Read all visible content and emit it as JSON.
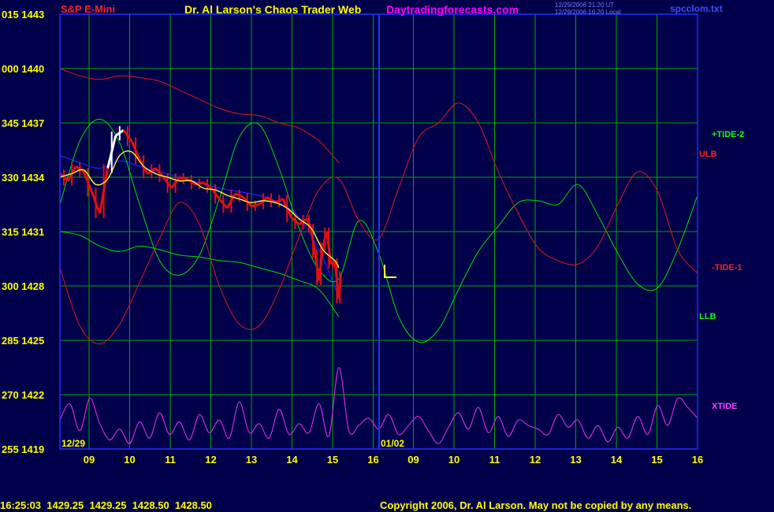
{
  "header": {
    "instrument": "S&P E-Mini",
    "title": "Dr. Al Larson's Chaos Trader Web",
    "website": "Daytradingforecasts.com",
    "timestamp_ut": "12/29/2006 21:20 UT",
    "timestamp_local": "12/29/2006 16:20 Local",
    "file": "spcclom.txt"
  },
  "footer": {
    "quote": "16:25:03  1429.25  1429.25  1428.50  1428.50",
    "copyright": "Copyright 2006, Dr. Al Larson. May not be copied by any means."
  },
  "side_labels": {
    "tide2": "+TIDE-2",
    "ulb": "ULB",
    "tide1": "-TIDE-1",
    "llb": "LLB",
    "xtide": "XTIDE"
  },
  "annotation_marker": "L",
  "colors": {
    "background": "#00004a",
    "grid": "#00a800",
    "axis": "#2030ff",
    "price_down": "#e01010",
    "price_up": "#ffffff",
    "ma_yellow": "#ffff40",
    "ma_blue": "#2222ff",
    "tide_green": "#00e000",
    "ulb_red": "#e01818",
    "xtide_magenta": "#ee30ee",
    "title_yellow": "#ffff00",
    "website_magenta": "#ff00ff"
  },
  "chart_data": {
    "type": "line",
    "title": "Dr. Al Larson's Chaos Trader Web",
    "subtitle": "S&P E-Mini",
    "y_ticks": [
      {
        "osc": "015",
        "price": "1443"
      },
      {
        "osc": "000",
        "price": "1440"
      },
      {
        "osc": "345",
        "price": "1437"
      },
      {
        "osc": "330",
        "price": "1434"
      },
      {
        "osc": "315",
        "price": "1431"
      },
      {
        "osc": "300",
        "price": "1428"
      },
      {
        "osc": "285",
        "price": "1425"
      },
      {
        "osc": "270",
        "price": "1422"
      },
      {
        "osc": "255",
        "price": "1419"
      }
    ],
    "ylim": [
      1419,
      1443
    ],
    "x_ticks": [
      "09",
      "10",
      "11",
      "12",
      "13",
      "14",
      "15",
      "16",
      "09",
      "10",
      "11",
      "12",
      "13",
      "14",
      "15",
      "16"
    ],
    "date_labels": [
      "12/29",
      "01/02"
    ],
    "session_split_hour_index": 7.1,
    "series": [
      {
        "name": "S&P E-Mini",
        "x": [
          0,
          0.2,
          0.4,
          0.6,
          0.8,
          1,
          1.2,
          1.4,
          1.6,
          1.8,
          2,
          2.2,
          2.4,
          2.6,
          2.8,
          3,
          3.2,
          3.4,
          3.6,
          3.8,
          4,
          4.2,
          4.4,
          4.6,
          4.8,
          5,
          5.2,
          5.4,
          5.6,
          5.8,
          6,
          6.2,
          6.3,
          6.4,
          6.5,
          6.6,
          6.7,
          6.8,
          6.9,
          7,
          7.05
        ],
        "y": [
          1434.2,
          1433.8,
          1434.6,
          1434.3,
          1433.2,
          1432.0,
          1434.5,
          1436.3,
          1436.6,
          1436.0,
          1435.0,
          1434.2,
          1434.5,
          1434.0,
          1433.4,
          1434.0,
          1433.9,
          1433.6,
          1433.7,
          1433.4,
          1432.8,
          1432.3,
          1433.1,
          1432.9,
          1432.4,
          1432.5,
          1432.9,
          1432.6,
          1432.8,
          1431.8,
          1431.4,
          1431.7,
          1431.2,
          1429.8,
          1428.3,
          1430.2,
          1431.0,
          1429.2,
          1429.3,
          1427.3,
          1428.6
        ]
      },
      {
        "name": "Moving average (yellow)",
        "x": [
          0,
          0.3,
          0.6,
          0.9,
          1.2,
          1.5,
          1.8,
          2.1,
          2.4,
          2.7,
          3,
          3.3,
          3.6,
          3.9,
          4.2,
          4.5,
          4.8,
          5.1,
          5.4,
          5.7,
          6,
          6.3,
          6.6,
          6.9,
          7
        ],
        "y": [
          1434.0,
          1434.2,
          1434.4,
          1433.6,
          1433.9,
          1435.2,
          1435.4,
          1434.6,
          1434.2,
          1434.0,
          1433.8,
          1433.8,
          1433.4,
          1433.3,
          1433.0,
          1432.8,
          1432.6,
          1432.7,
          1432.6,
          1432.3,
          1431.7,
          1431.2,
          1430.0,
          1429.4,
          1429.0
        ]
      },
      {
        "name": "Moving average (blue)",
        "x": [
          0,
          0.5,
          1,
          1.5,
          2,
          2.5,
          3,
          3.5,
          4,
          4.5,
          5,
          5.5,
          6,
          6.5,
          7
        ],
        "y": [
          1435.2,
          1434.8,
          1434.5,
          1434.9,
          1434.6,
          1434.3,
          1434.0,
          1433.7,
          1433.4,
          1433.2,
          1433.0,
          1432.6,
          1431.8,
          1430.0,
          1427.4
        ]
      },
      {
        "name": "+TIDE-2",
        "x": [
          0,
          0.5,
          1,
          1.5,
          2,
          2.5,
          3,
          3.5,
          4,
          4.5,
          5,
          5.5,
          6,
          6.5,
          7,
          7.5,
          8,
          8.5,
          9,
          9.5,
          10,
          10.5,
          11,
          11.5,
          12,
          12.5,
          13,
          13.5,
          14,
          14.5,
          15,
          15.5,
          16
        ],
        "y": [
          1432.5,
          1436.0,
          1437.2,
          1435.9,
          1432.5,
          1429.4,
          1428.6,
          1429.7,
          1432.8,
          1436.2,
          1436.9,
          1434.5,
          1431.2,
          1428.9,
          1428.4,
          1431.6,
          1429.8,
          1426.3,
          1424.9,
          1425.6,
          1427.8,
          1429.9,
          1431.3,
          1432.6,
          1432.7,
          1432.5,
          1433.6,
          1431.9,
          1429.8,
          1428.1,
          1427.9,
          1430.0,
          1433.0
        ]
      },
      {
        "name": "ULB",
        "x": [
          0,
          0.5,
          1,
          1.5,
          2,
          2.5,
          3,
          3.5,
          4,
          4.5,
          5,
          5.5,
          6,
          6.5,
          7
        ],
        "y": [
          1440.0,
          1439.6,
          1439.4,
          1439.6,
          1439.5,
          1439.3,
          1438.8,
          1438.3,
          1437.8,
          1437.5,
          1437.4,
          1437.0,
          1436.7,
          1436.0,
          1434.8
        ]
      },
      {
        "name": "-TIDE-1",
        "x": [
          0,
          0.5,
          1,
          1.5,
          2,
          2.5,
          3,
          3.5,
          4,
          4.5,
          5,
          5.5,
          6,
          6.5,
          7,
          7.5,
          8,
          8.5,
          9,
          9.5,
          10,
          10.5,
          11,
          11.5,
          12,
          12.5,
          13,
          13.5,
          14,
          14.5,
          15,
          15.5,
          16
        ],
        "y": [
          1429.0,
          1425.8,
          1424.8,
          1425.9,
          1428.2,
          1430.6,
          1432.6,
          1431.4,
          1428.0,
          1425.9,
          1425.8,
          1427.8,
          1430.7,
          1433.3,
          1433.9,
          1431.6,
          1430.6,
          1433.4,
          1436.2,
          1437.0,
          1438.1,
          1437.0,
          1434.3,
          1432.0,
          1430.1,
          1429.4,
          1429.2,
          1430.2,
          1432.5,
          1434.3,
          1433.2,
          1430.0,
          1428.7
        ]
      },
      {
        "name": "LLB",
        "x": [
          0,
          0.5,
          1,
          1.5,
          2,
          2.5,
          3,
          3.5,
          4,
          4.5,
          5,
          5.5,
          6,
          6.5,
          7
        ],
        "y": [
          1431.0,
          1430.8,
          1430.2,
          1429.9,
          1430.2,
          1430.0,
          1429.7,
          1429.6,
          1429.4,
          1429.3,
          1429.0,
          1428.7,
          1428.3,
          1427.8,
          1426.3
        ]
      },
      {
        "name": "XTIDE",
        "x": [
          0,
          0.25,
          0.5,
          0.75,
          1,
          1.25,
          1.5,
          1.75,
          2,
          2.25,
          2.5,
          2.75,
          3,
          3.25,
          3.5,
          3.75,
          4,
          4.25,
          4.5,
          4.75,
          5,
          5.25,
          5.5,
          5.75,
          6,
          6.25,
          6.5,
          6.75,
          7,
          7.25,
          7.5,
          7.75,
          8,
          8.25,
          8.5,
          8.75,
          9,
          9.25,
          9.5,
          9.75,
          10,
          10.25,
          10.5,
          10.75,
          11,
          11.25,
          11.5,
          11.75,
          12,
          12.25,
          12.5,
          12.75,
          13,
          13.25,
          13.5,
          13.75,
          14,
          14.25,
          14.5,
          14.75,
          15,
          15.25,
          15.5,
          15.75,
          16
        ],
        "y": [
          1420.6,
          1421.5,
          1420.0,
          1421.8,
          1420.4,
          1419.5,
          1420.1,
          1419.3,
          1420.5,
          1419.6,
          1421.0,
          1419.8,
          1420.5,
          1419.5,
          1420.9,
          1419.9,
          1420.6,
          1419.6,
          1421.6,
          1419.9,
          1420.4,
          1419.6,
          1421.2,
          1419.8,
          1420.4,
          1419.9,
          1421.5,
          1419.7,
          1423.5,
          1420.0,
          1420.3,
          1420.7,
          1420.1,
          1420.9,
          1419.8,
          1420.3,
          1420.8,
          1420.0,
          1419.3,
          1420.2,
          1421.0,
          1420.1,
          1421.3,
          1419.9,
          1420.8,
          1419.7,
          1420.6,
          1420.3,
          1420.1,
          1419.8,
          1420.9,
          1420.2,
          1420.6,
          1419.6,
          1420.3,
          1419.4,
          1420.2,
          1419.6,
          1420.8,
          1419.8,
          1421.4,
          1420.3,
          1421.8,
          1421.3,
          1420.7
        ]
      }
    ]
  }
}
